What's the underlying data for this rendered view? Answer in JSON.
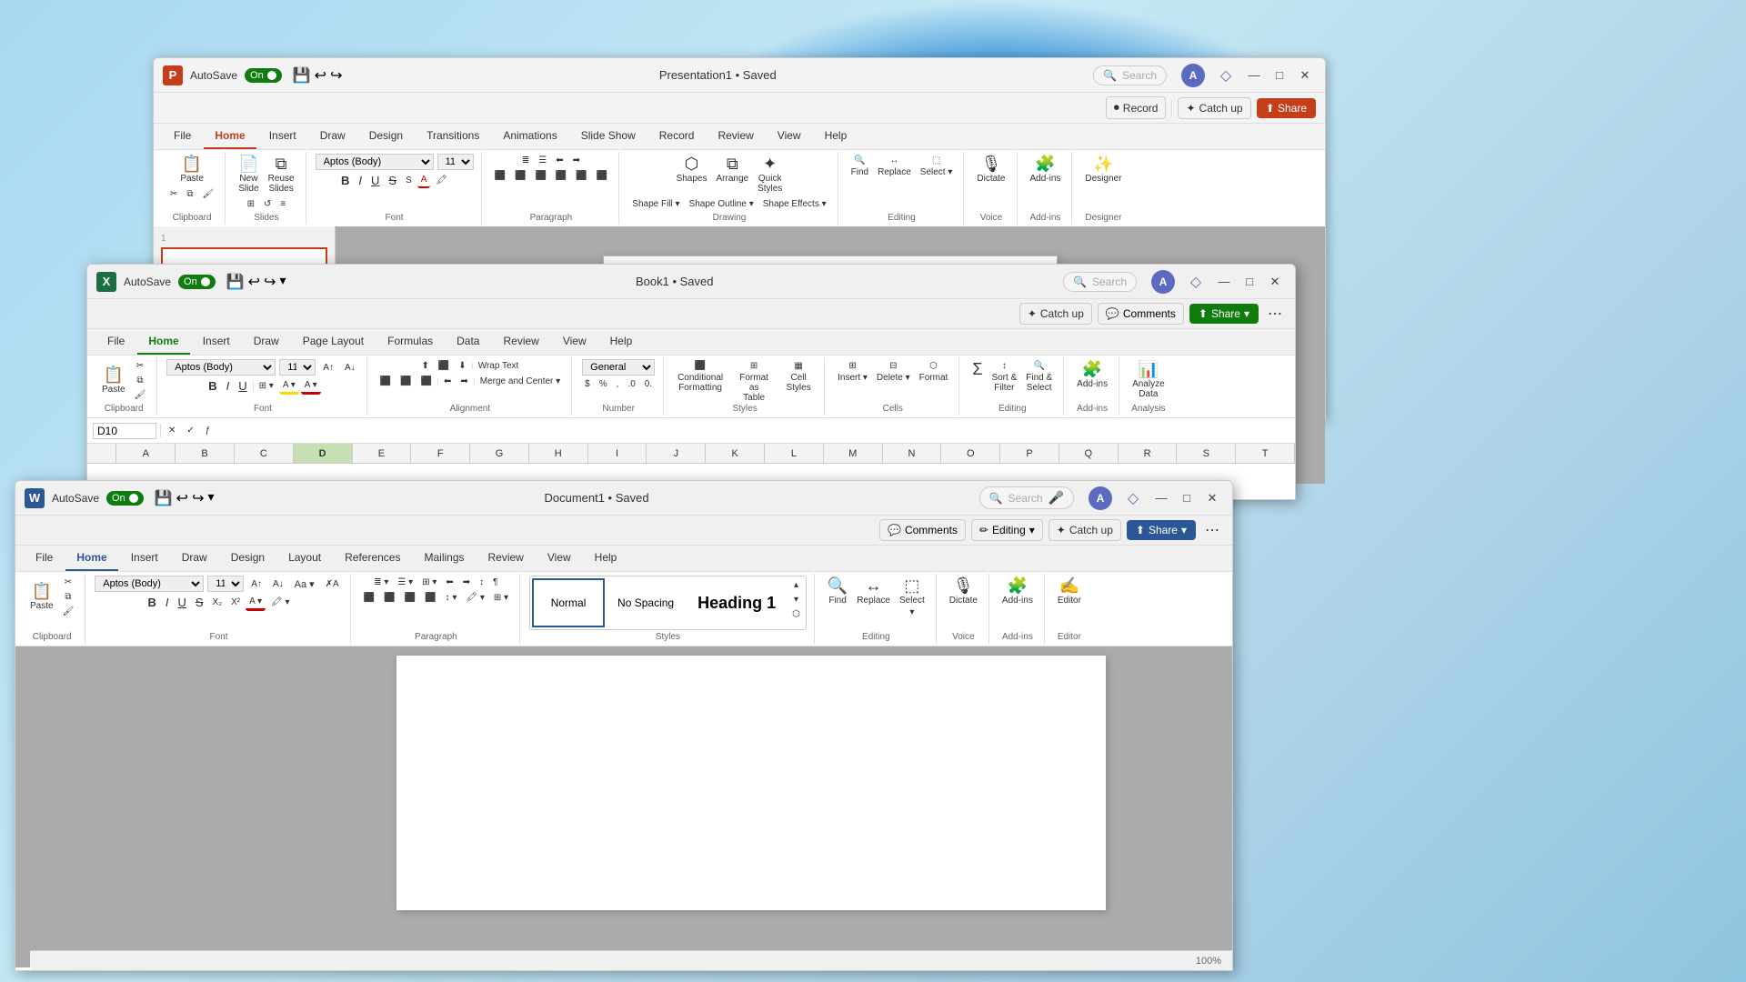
{
  "background": {
    "color": "#a8d8f0"
  },
  "ppt": {
    "logo": "P",
    "autosave_label": "AutoSave",
    "autosave_state": "On",
    "title": "Presentation1 • Saved",
    "search_placeholder": "Search",
    "record_label": "Record",
    "catchup_label": "Catch up",
    "share_label": "Share",
    "tabs": [
      "File",
      "Home",
      "Insert",
      "Draw",
      "Design",
      "Transitions",
      "Animations",
      "Slide Show",
      "Record",
      "Review",
      "View",
      "Help"
    ],
    "active_tab": "Home",
    "groups": {
      "clipboard": "Clipboard",
      "slides": "Slides",
      "font": "Font",
      "paragraph": "Paragraph",
      "drawing": "Drawing",
      "editing": "Editing",
      "voice": "Voice",
      "addins": "Add-ins",
      "designer": "Designer"
    },
    "font_name": "Aptos (Body)",
    "font_size": "11"
  },
  "excel": {
    "logo": "X",
    "autosave_label": "AutoSave",
    "autosave_state": "On",
    "title": "Book1 • Saved",
    "search_placeholder": "Search",
    "catchup_label": "Catch up",
    "comments_label": "Comments",
    "share_label": "Share",
    "tabs": [
      "File",
      "Home",
      "Insert",
      "Draw",
      "Page Layout",
      "Formulas",
      "Data",
      "Review",
      "View",
      "Help"
    ],
    "active_tab": "Home",
    "groups": {
      "clipboard": "Clipboard",
      "font": "Font",
      "alignment": "Alignment",
      "number": "Number",
      "styles": "Styles",
      "cells": "Cells",
      "editing": "Editing",
      "addins": "Add-ins",
      "analysis": "Analysis"
    },
    "font_name": "Aptos (Body)",
    "font_size": "11",
    "cell_ref": "D10",
    "formula_value": "",
    "columns": [
      "A",
      "B",
      "C",
      "D",
      "E",
      "F",
      "G",
      "H",
      "I",
      "J",
      "K",
      "L",
      "M",
      "N",
      "O",
      "P",
      "Q",
      "R",
      "S",
      "T"
    ],
    "number_format": "General",
    "styles": {
      "conditional_formatting": "Conditional Formatting",
      "format_as_table": "Format as Table",
      "cell_styles": "Cell Styles"
    },
    "cells_group": {
      "insert": "Insert",
      "delete": "Delete",
      "format": "Format"
    },
    "editing_group": {
      "sum": "Σ",
      "sort_filter": "Sort & Filter",
      "find_select": "Find & Select"
    }
  },
  "word": {
    "logo": "W",
    "autosave_label": "AutoSave",
    "autosave_state": "On",
    "title": "Document1 • Saved",
    "search_placeholder": "Search",
    "catchup_label": "Catch up",
    "comments_label": "Comments",
    "editing_label": "Editing",
    "share_label": "Share",
    "tabs": [
      "File",
      "Home",
      "Insert",
      "Draw",
      "Design",
      "Layout",
      "References",
      "Mailings",
      "Review",
      "View",
      "Help"
    ],
    "active_tab": "Home",
    "groups": {
      "clipboard": "Clipboard",
      "font": "Font",
      "paragraph": "Paragraph",
      "styles": "Styles",
      "editing": "Editing",
      "voice": "Voice",
      "addins": "Add-ins",
      "editor": "Editor"
    },
    "font_name": "Aptos (Body)",
    "font_size": "11",
    "styles_items": [
      "Normal",
      "No Spacing",
      "Heading 1"
    ],
    "active_style": "Normal",
    "editing_options": {
      "find": "Find",
      "replace": "Replace",
      "select": "Select"
    },
    "zoom": "100%"
  },
  "icons": {
    "search": "🔍",
    "undo": "↩",
    "redo": "↪",
    "save": "💾",
    "minimize": "—",
    "maximize": "□",
    "close": "✕",
    "paste": "📋",
    "cut": "✂",
    "copy": "⧉",
    "bold": "B",
    "italic": "I",
    "underline": "U",
    "strikethrough": "S",
    "font_increase": "A↑",
    "font_decrease": "A↓",
    "align_left": "≡",
    "center": "☰",
    "bullet": "≣",
    "copilot": "◇",
    "mic": "🎤",
    "record_dot": "⏺",
    "comment": "💬",
    "shapes": "⬡",
    "arrange": "⧉",
    "dictate": "🎙",
    "addins": "🧩",
    "designer": "✨",
    "chevron_down": "▾",
    "chevron_up": "▴",
    "down_arrow": "▾"
  }
}
